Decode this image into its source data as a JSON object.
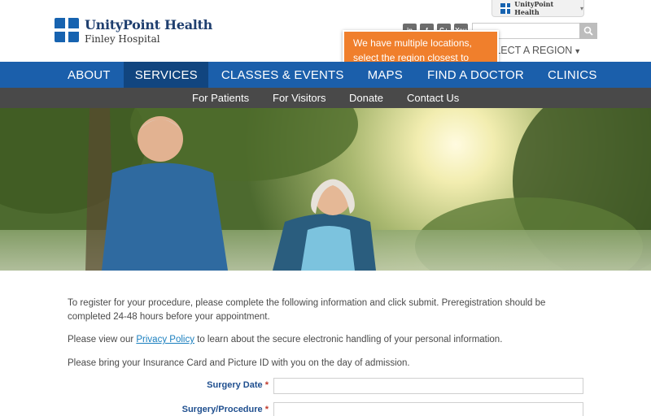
{
  "brand": {
    "name": "UnityPoint Health",
    "location": "Finley Hospital",
    "tab_label": "UnityPoint Health"
  },
  "social": [
    "in",
    "f",
    "G+",
    "You"
  ],
  "search": {
    "placeholder": ""
  },
  "region": {
    "label": "ELECT A REGION"
  },
  "tooltip": {
    "text": "We have multiple locations, select the region closest to you."
  },
  "main_nav": [
    {
      "label": "ABOUT",
      "active": false
    },
    {
      "label": "SERVICES",
      "active": true
    },
    {
      "label": "CLASSES & EVENTS",
      "active": false
    },
    {
      "label": "MAPS",
      "active": false
    },
    {
      "label": "FIND A DOCTOR",
      "active": false
    },
    {
      "label": "CLINICS",
      "active": false
    }
  ],
  "sub_nav": [
    "For Patients",
    "For Visitors",
    "Donate",
    "Contact Us"
  ],
  "content": {
    "intro": "To register for your procedure, please complete the following information and click submit.  Preregistration should be completed 24-48 hours before your appointment.",
    "privacy_before": "Please view our ",
    "privacy_link": "Privacy Policy",
    "privacy_after": " to learn about the secure electronic handling of your personal information.",
    "bring": "Please bring your Insurance Card and Picture ID with you on the day of admission."
  },
  "form": {
    "surgery_date_label": "Surgery Date",
    "procedure_label": "Surgery/Procedure",
    "required_mark": "*"
  },
  "colors": {
    "brand_blue": "#1b5fab",
    "active_nav": "#11457f",
    "subnav_gray": "#494949",
    "tooltip_orange": "#f07f2c"
  }
}
